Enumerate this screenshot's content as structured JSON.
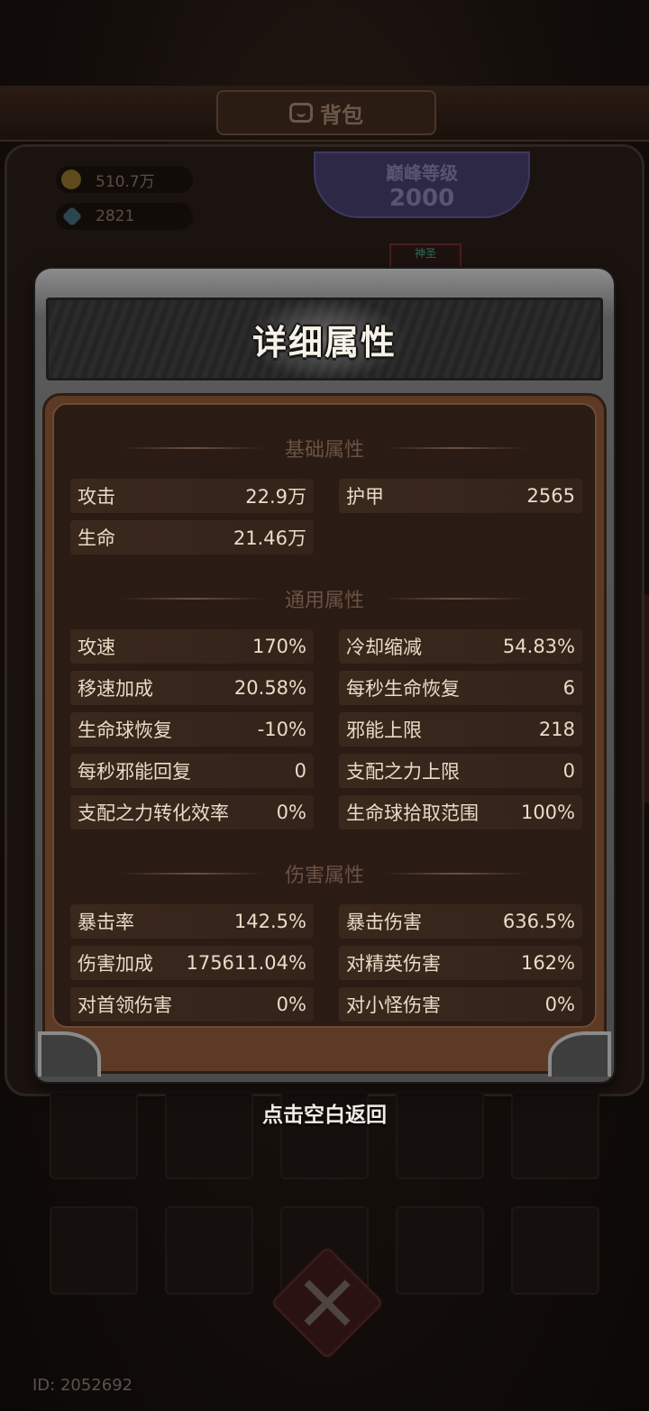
{
  "background": {
    "tab_title": "背包",
    "coins": "510.7万",
    "gems": "2821",
    "peak_label": "巅峰等级",
    "peak_level": "2000",
    "slot_label": "神圣",
    "player_id": "ID: 2052692"
  },
  "modal": {
    "title": "详细属性",
    "sections": {
      "basic": {
        "heading": "基础属性",
        "stats": [
          {
            "label": "攻击",
            "value": "22.9万"
          },
          {
            "label": "护甲",
            "value": "2565"
          },
          {
            "label": "生命",
            "value": "21.46万"
          }
        ]
      },
      "general": {
        "heading": "通用属性",
        "stats": [
          {
            "label": "攻速",
            "value": "170%"
          },
          {
            "label": "冷却缩减",
            "value": "54.83%"
          },
          {
            "label": "移速加成",
            "value": "20.58%"
          },
          {
            "label": "每秒生命恢复",
            "value": "6"
          },
          {
            "label": "生命球恢复",
            "value": "-10%"
          },
          {
            "label": "邪能上限",
            "value": "218"
          },
          {
            "label": "每秒邪能回复",
            "value": "0"
          },
          {
            "label": "支配之力上限",
            "value": "0"
          },
          {
            "label": "支配之力转化效率",
            "value": "0%"
          },
          {
            "label": "生命球拾取范围",
            "value": "100%"
          }
        ]
      },
      "damage": {
        "heading": "伤害属性",
        "stats": [
          {
            "label": "暴击率",
            "value": "142.5%"
          },
          {
            "label": "暴击伤害",
            "value": "636.5%"
          },
          {
            "label": "伤害加成",
            "value": "175611.04%"
          },
          {
            "label": "对精英伤害",
            "value": "162%"
          },
          {
            "label": "对首领伤害",
            "value": "0%"
          },
          {
            "label": "对小怪伤害",
            "value": "0%"
          }
        ]
      }
    },
    "return_hint": "点击空白返回"
  }
}
